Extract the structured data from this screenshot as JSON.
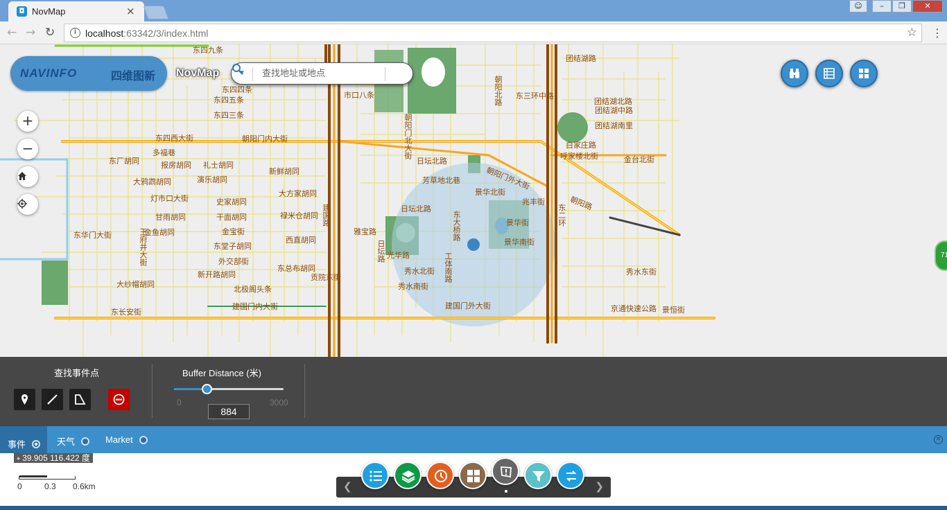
{
  "browser": {
    "tab_title": "NovMap",
    "tab_close": "×",
    "url_host": "localhost",
    "url_rest": ":63342/3/index.html"
  },
  "header": {
    "logo_latin": "NAVINFO",
    "logo_cn": "四维图新",
    "app_title": "NovMap",
    "search_placeholder": "查找地址或地点"
  },
  "map_labels": [
    "东四九条",
    "东四五条",
    "东四三条",
    "东四四条",
    "东四西大街",
    "朝阳门内大街",
    "朝阳门北大街",
    "多福巷",
    "报房胡同",
    "礼士胡同",
    "东厂胡同",
    "大鸦鹉胡同",
    "演乐胡同",
    "灯市口大街",
    "史家胡同",
    "干面胡同",
    "甘雨胡同",
    "金鱼胡同",
    "金宝街",
    "东堂子胡同",
    "外交部街",
    "新开路胡同",
    "东总布胡同",
    "北极阁头条",
    "大纱帽胡同",
    "建国门内大街",
    "东长安街",
    "东华门大街",
    "王府井大街",
    "新鲜胡同",
    "大方家胡同",
    "禄米仓胡同",
    "西直胡同",
    "贡院东街",
    "雅宝路",
    "市口八条",
    "日坛北路",
    "日坛路",
    "秀水北街",
    "秀水南街",
    "东大桥路",
    "朝阳门外大街",
    "芳草地北巷",
    "日坛北路",
    "景华北街",
    "景华街",
    "景华南街",
    "光华路",
    "建国门外大街",
    "兆丰街",
    "朝阳路",
    "呼家楼北街",
    "金台北街",
    "团结湖路",
    "团结湖北路",
    "团结湖中路",
    "团结湖南里",
    "白家庄路",
    "东三环中路",
    "东二环",
    "建国路",
    "京通快速公路",
    "景恒街",
    "秀水东街",
    "工体南路",
    "朝阳北路"
  ],
  "map_controls": {
    "zoom_in": "+",
    "zoom_out": "−",
    "side_badge": "71"
  },
  "panel": {
    "find_events_title": "查找事件点",
    "buffer_label": "Buffer Distance (米)",
    "slider_min": "0",
    "slider_max": "3000",
    "buffer_value": "884",
    "buffer_value_num": 884,
    "buffer_max_num": 3000
  },
  "layers": {
    "tabs": [
      "事件",
      "天气",
      "Market"
    ],
    "active": "事件"
  },
  "status": {
    "coordinates": "39.905 116.422 度",
    "scale_0": "0",
    "scale_1": "0.3",
    "scale_2": "0.6km"
  },
  "dock": {
    "buttons": [
      {
        "icon": "list-icon",
        "color": "#1ea0e0"
      },
      {
        "icon": "layers-icon",
        "color": "#0d9a46"
      },
      {
        "icon": "history-icon",
        "color": "#e06020"
      },
      {
        "icon": "calculator-icon",
        "color": "#8a6a4a"
      },
      {
        "icon": "alert-icon",
        "color": "#666666"
      },
      {
        "icon": "filter-icon",
        "color": "#5bc0c8"
      },
      {
        "icon": "route-icon",
        "color": "#1ea0e0"
      }
    ]
  },
  "colors": {
    "accent": "#3b8fca",
    "panel": "#474747",
    "stop": "#c40000"
  }
}
